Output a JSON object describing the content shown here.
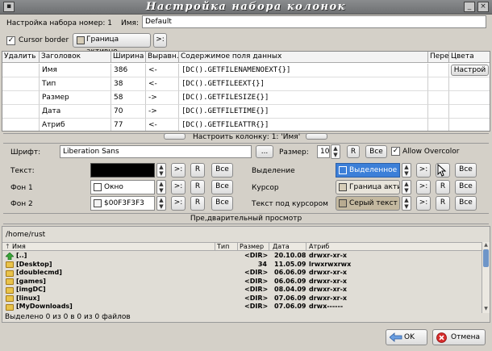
{
  "window": {
    "title": "Настройка набора колонок"
  },
  "header": {
    "set_number_label": "Настройка набора номер: 1",
    "name_label": "Имя:",
    "name_value": "Default"
  },
  "options": {
    "cursor_border_label": "Cursor border",
    "cursor_border_checked": "✓",
    "border_active_label": "Граница активно",
    "arrow_button": ">:"
  },
  "grid": {
    "headers": [
      "Удалить",
      "Заголовок",
      "Ширина",
      "Выравн.",
      "Содержимое поля данных",
      "Пере",
      "Цвета"
    ],
    "rows": [
      {
        "title": "Имя",
        "width": "386",
        "align": "<-",
        "content": "[DC().GETFILENAMENOEXT{}]"
      },
      {
        "title": "Тип",
        "width": "38",
        "align": "<-",
        "content": "[DC().GETFILEEXT{}]"
      },
      {
        "title": "Размер",
        "width": "58",
        "align": "->",
        "content": "[DC().GETFILESIZE{}]"
      },
      {
        "title": "Дата",
        "width": "70",
        "align": "->",
        "content": "[DC().GETFILETIME{}]"
      },
      {
        "title": "Атриб",
        "width": "77",
        "align": "<-",
        "content": "[DC().GETFILEATTR{}]"
      }
    ],
    "settings_button": "Настрой"
  },
  "configure_column": {
    "label": "Настроить колонку: 1: 'Имя'"
  },
  "font": {
    "label": "Шрифт:",
    "value": "Liberation Sans",
    "browse": "...",
    "size_label": "Размер:",
    "size_value": "10",
    "r_button": "R",
    "all_button": "Все",
    "overcolor_label": "Allow Overcolor",
    "overcolor_checked": "✓"
  },
  "colors": {
    "text_label": "Текст:",
    "bg1_label": "Фон 1",
    "bg2_label": "Фон 2",
    "bg1_value": "Окно",
    "bg2_value": "$00F3F3F3",
    "selection_label": "Выделение",
    "cursor_label": "Курсор",
    "cursor_text_label": "Текст под курсором",
    "selection_value": "Выделенное",
    "cursor_value": "Граница активно",
    "cursor_text_value": "Серый текст",
    "arrow": ">:",
    "r": "R",
    "all": "Все",
    "text_swatch": "#000000",
    "bg1_swatch": "#ffffff",
    "bg2_swatch": "#f3f3f3",
    "selection_swatch": "#3c7fd8",
    "cursor_swatch": "#d6cdb8",
    "cursor_text_swatch": "#b8ab90"
  },
  "preview": {
    "label": "Пре,дварительный просмотр",
    "path": "/home/rust",
    "headers": [
      "Имя",
      "Тип",
      "Размер",
      "Дата",
      "Атриб"
    ],
    "rows": [
      {
        "name": "[..]",
        "size": "<DIR>",
        "date": "20.10.08",
        "attr": "drwxr-xr-x"
      },
      {
        "name": "[Desktop]",
        "size": "34",
        "date": "11.05.09",
        "attr": "lrwxrwxrwx"
      },
      {
        "name": "[doublecmd]",
        "size": "<DIR>",
        "date": "06.06.09",
        "attr": "drwxr-xr-x"
      },
      {
        "name": "[games]",
        "size": "<DIR>",
        "date": "06.06.09",
        "attr": "drwxr-xr-x"
      },
      {
        "name": "[imgDC]",
        "size": "<DIR>",
        "date": "08.04.09",
        "attr": "drwxr-xr-x"
      },
      {
        "name": "[linux]",
        "size": "<DIR>",
        "date": "07.06.09",
        "attr": "drwxr-xr-x"
      },
      {
        "name": "[MyDownloads]",
        "size": "<DIR>",
        "date": "07.06.09",
        "attr": "drwx------"
      }
    ],
    "status": "Выделено 0 из 0 в 0 из 0 файлов"
  },
  "footer": {
    "ok": "OK",
    "cancel": "Отмена"
  }
}
